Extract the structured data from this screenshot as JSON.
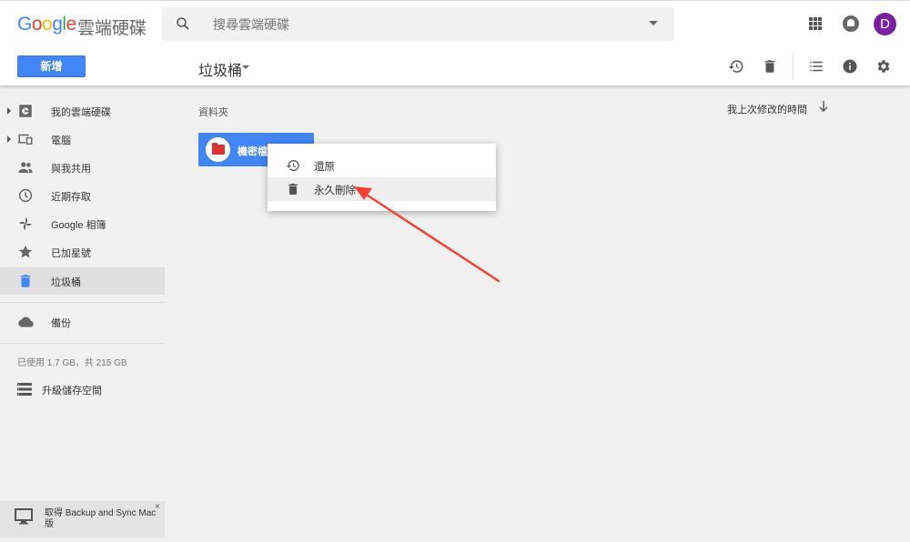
{
  "header": {
    "logo_letters": [
      "G",
      "o",
      "o",
      "g",
      "l",
      "e"
    ],
    "product_name": "雲端硬碟",
    "search_placeholder": "搜尋雲端硬碟",
    "avatar_initial": "D"
  },
  "toolbar": {
    "new_button_label": "新增",
    "location_title": "垃圾桶"
  },
  "sidebar": {
    "items": [
      {
        "label": "我的雲端硬碟",
        "icon": "drive-icon"
      },
      {
        "label": "電腦",
        "icon": "computers-icon"
      },
      {
        "label": "與我共用",
        "icon": "shared-icon"
      },
      {
        "label": "近期存取",
        "icon": "recent-icon"
      },
      {
        "label": "Google 相簿",
        "icon": "photos-icon"
      },
      {
        "label": "已加星號",
        "icon": "star-icon"
      },
      {
        "label": "垃圾桶",
        "icon": "trash-icon",
        "active": true
      }
    ],
    "backup_label": "備份",
    "storage_text": "已使用 1.7 GB，共 215 GB",
    "upgrade_label": "升級儲存空間",
    "promo_text": "取得 Backup and Sync Mac 版",
    "promo_close": "×"
  },
  "main": {
    "section_label": "資料夾",
    "sort_label": "我上次修改的時間",
    "folder_name": "機密檔案"
  },
  "context_menu": {
    "items": [
      {
        "label": "還原",
        "icon": "restore-icon"
      },
      {
        "label": "永久刪除",
        "icon": "delete-forever-icon"
      }
    ]
  },
  "colors": {
    "accent": "#4285f4",
    "avatar": "#7b1fa2",
    "folder_icon": "#db3236",
    "annotation_arrow": "#f44336"
  }
}
